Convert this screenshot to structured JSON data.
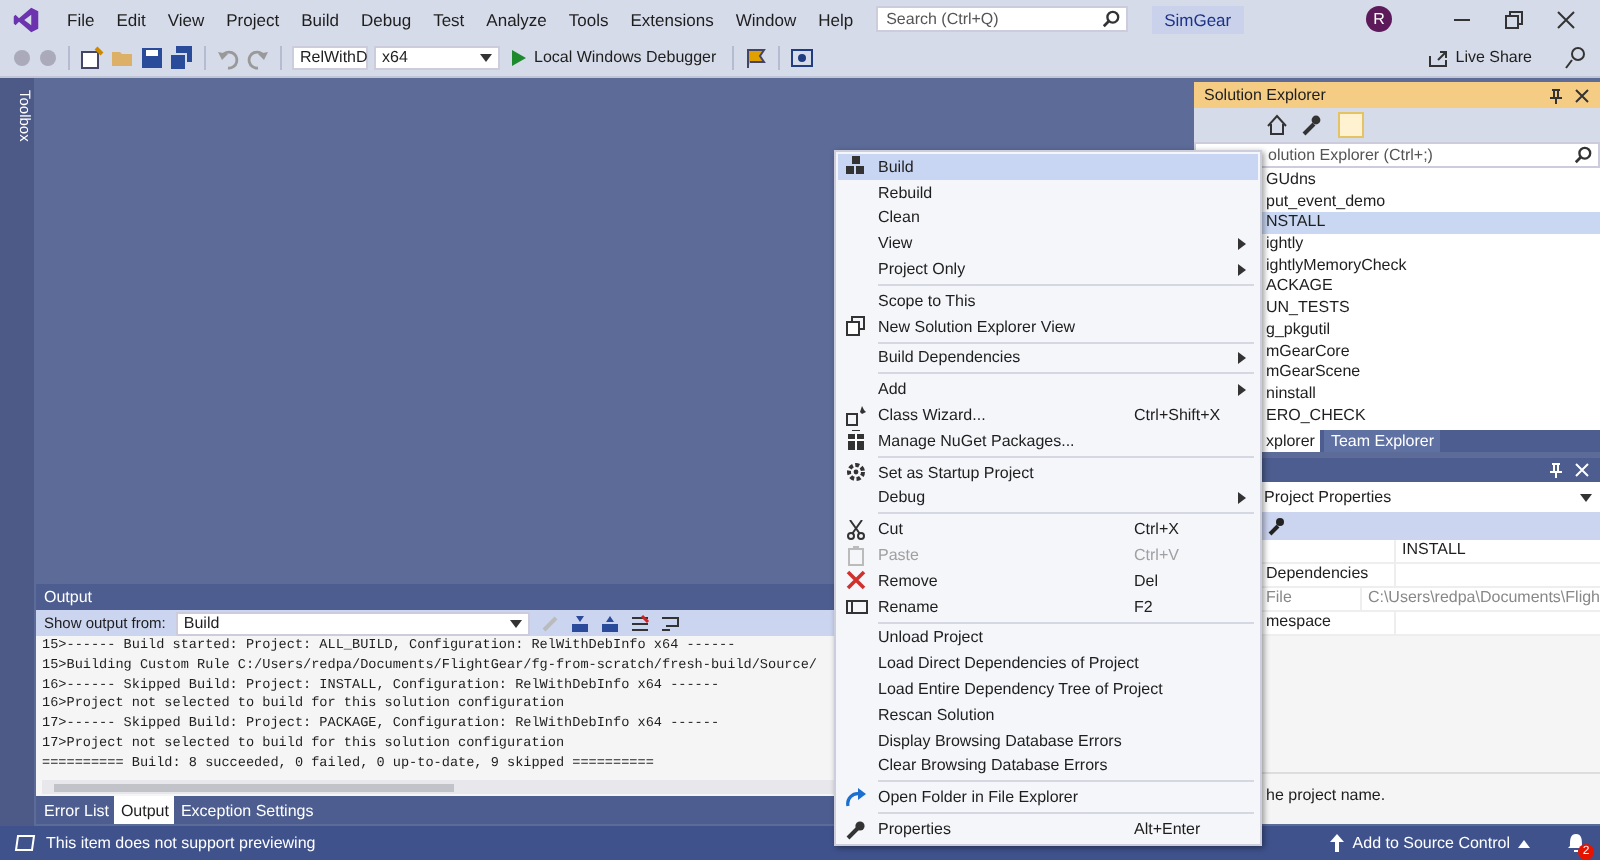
{
  "title_bar": {
    "menu": [
      "File",
      "Edit",
      "View",
      "Project",
      "Build",
      "Debug",
      "Test",
      "Analyze",
      "Tools",
      "Extensions",
      "Window",
      "Help"
    ],
    "search": {
      "placeholder": "Search (Ctrl+Q)"
    },
    "solution_name": "SimGear",
    "avatar": "R"
  },
  "toolbar": {
    "configuration": "RelWithD",
    "platform": "x64",
    "debugger": "Local Windows Debugger",
    "live_share": "Live Share"
  },
  "toolbox": {
    "label": "Toolbox"
  },
  "output": {
    "title": "Output",
    "source_label": "Show output from:",
    "source": "Build",
    "lines": [
      "15>------ Build started: Project: ALL_BUILD, Configuration: RelWithDebInfo x64 ------",
      "15>Building Custom Rule C:/Users/redpa/Documents/FlightGear/fg-from-scratch/fresh-build/Source/",
      "16>------ Skipped Build: Project: INSTALL, Configuration: RelWithDebInfo x64 ------",
      "16>Project not selected to build for this solution configuration",
      "17>------ Skipped Build: Project: PACKAGE, Configuration: RelWithDebInfo x64 ------",
      "17>Project not selected to build for this solution configuration",
      "========== Build: 8 succeeded, 0 failed, 0 up-to-date, 9 skipped =========="
    ],
    "tabs": [
      {
        "label": "Error List",
        "selected": false
      },
      {
        "label": "Output",
        "selected": true
      },
      {
        "label": "Exception Settings",
        "selected": false
      }
    ]
  },
  "solution_explorer": {
    "title": "Solution Explorer",
    "search": {
      "placeholder": "olution Explorer (Ctrl+;)"
    },
    "items": [
      {
        "label": "GUdns",
        "selected": false
      },
      {
        "label": "put_event_demo",
        "selected": false
      },
      {
        "label": "NSTALL",
        "selected": true
      },
      {
        "label": "ightly",
        "selected": false
      },
      {
        "label": "ightlyMemoryCheck",
        "selected": false
      },
      {
        "label": "ACKAGE",
        "selected": false
      },
      {
        "label": "UN_TESTS",
        "selected": false
      },
      {
        "label": "g_pkgutil",
        "selected": false
      },
      {
        "label": "mGearCore",
        "selected": false
      },
      {
        "label": "mGearScene",
        "selected": false
      },
      {
        "label": "ninstall",
        "selected": false
      },
      {
        "label": "ERO_CHECK",
        "selected": false
      }
    ],
    "tabs": [
      {
        "label": "xplorer",
        "selected": true
      },
      {
        "label": "Team Explorer",
        "selected": false
      }
    ]
  },
  "properties": {
    "object": "Project Properties",
    "rows": [
      {
        "value": "INSTALL",
        "disabled": false
      },
      {
        "name": "Dependencies",
        "disabled": false
      },
      {
        "name": "File",
        "value": "C:\\Users\\redpa\\Documents\\Fligh",
        "disabled": true
      },
      {
        "name": "mespace",
        "disabled": false
      }
    ],
    "description": "he project name."
  },
  "context_menu": {
    "entries": [
      {
        "kind": "item",
        "label": "Build",
        "selected": true,
        "submenu": false,
        "disabled": false
      },
      {
        "kind": "item",
        "label": "Rebuild",
        "selected": false,
        "submenu": false,
        "disabled": false
      },
      {
        "kind": "item",
        "label": "Clean",
        "selected": false,
        "submenu": false,
        "disabled": false
      },
      {
        "kind": "item",
        "label": "View",
        "selected": false,
        "submenu": true,
        "disabled": false
      },
      {
        "kind": "item",
        "label": "Project Only",
        "selected": false,
        "submenu": true,
        "disabled": false
      },
      {
        "kind": "separator"
      },
      {
        "kind": "item",
        "label": "Scope to This",
        "selected": false,
        "submenu": false,
        "disabled": false
      },
      {
        "kind": "item",
        "label": "New Solution Explorer View",
        "selected": false,
        "submenu": false,
        "disabled": false
      },
      {
        "kind": "separator"
      },
      {
        "kind": "item",
        "label": "Build Dependencies",
        "selected": false,
        "submenu": true,
        "disabled": false
      },
      {
        "kind": "separator"
      },
      {
        "kind": "item",
        "label": "Add",
        "selected": false,
        "submenu": true,
        "disabled": false
      },
      {
        "kind": "item",
        "label": "Class Wizard...",
        "shortcut": "Ctrl+Shift+X",
        "selected": false,
        "submenu": false,
        "disabled": false
      },
      {
        "kind": "item",
        "label": "Manage NuGet Packages...",
        "selected": false,
        "submenu": false,
        "disabled": false
      },
      {
        "kind": "separator"
      },
      {
        "kind": "item",
        "label": "Set as Startup Project",
        "selected": false,
        "submenu": false,
        "disabled": false
      },
      {
        "kind": "item",
        "label": "Debug",
        "selected": false,
        "submenu": true,
        "disabled": false
      },
      {
        "kind": "separator"
      },
      {
        "kind": "item",
        "label": "Cut",
        "shortcut": "Ctrl+X",
        "selected": false,
        "submenu": false,
        "disabled": false
      },
      {
        "kind": "item",
        "label": "Paste",
        "shortcut": "Ctrl+V",
        "selected": false,
        "submenu": false,
        "disabled": true
      },
      {
        "kind": "item",
        "label": "Remove",
        "shortcut": "Del",
        "selected": false,
        "submenu": false,
        "disabled": false
      },
      {
        "kind": "item",
        "label": "Rename",
        "shortcut": "F2",
        "selected": false,
        "submenu": false,
        "disabled": false
      },
      {
        "kind": "separator"
      },
      {
        "kind": "item",
        "label": "Unload Project",
        "selected": false,
        "submenu": false,
        "disabled": false
      },
      {
        "kind": "item",
        "label": "Load Direct Dependencies of Project",
        "selected": false,
        "submenu": false,
        "disabled": false
      },
      {
        "kind": "item",
        "label": "Load Entire Dependency Tree of Project",
        "selected": false,
        "submenu": false,
        "disabled": false
      },
      {
        "kind": "item",
        "label": "Rescan Solution",
        "selected": false,
        "submenu": false,
        "disabled": false
      },
      {
        "kind": "item",
        "label": "Display Browsing Database Errors",
        "selected": false,
        "submenu": false,
        "disabled": false
      },
      {
        "kind": "item",
        "label": "Clear Browsing Database Errors",
        "selected": false,
        "submenu": false,
        "disabled": false
      },
      {
        "kind": "separator"
      },
      {
        "kind": "item",
        "label": "Open Folder in File Explorer",
        "selected": false,
        "submenu": false,
        "disabled": false
      },
      {
        "kind": "separator"
      },
      {
        "kind": "item",
        "label": "Properties",
        "shortcut": "Alt+Enter",
        "selected": false,
        "submenu": false,
        "disabled": false
      }
    ]
  },
  "status_bar": {
    "message": "This item does not support previewing",
    "source_control": "Add to Source Control",
    "notifications": "2"
  }
}
